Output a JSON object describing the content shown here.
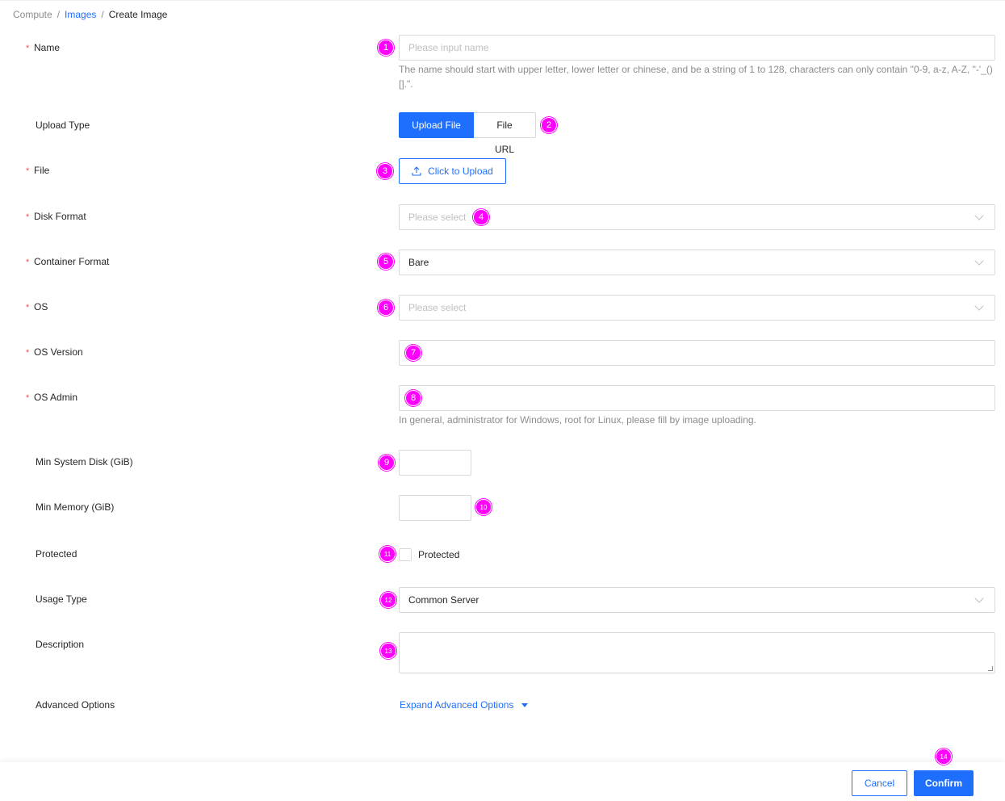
{
  "breadcrumb": {
    "items": [
      "Compute",
      "Images",
      "Create Image"
    ],
    "sep": "/"
  },
  "required_mark": "*",
  "form": {
    "name": {
      "label": "Name",
      "placeholder": "Please input name",
      "help": "The name should start with upper letter, lower letter or chinese, and be a string of 1 to 128, characters can only contain \"0-9, a-z, A-Z, \"-'_()[].\"."
    },
    "upload_type": {
      "label": "Upload Type",
      "options": [
        "Upload File",
        "File URL"
      ],
      "selected": "Upload File"
    },
    "file": {
      "label": "File",
      "button": "Click to Upload"
    },
    "disk_format": {
      "label": "Disk Format",
      "placeholder": "Please select"
    },
    "container_format": {
      "label": "Container Format",
      "value": "Bare"
    },
    "os": {
      "label": "OS",
      "placeholder": "Please select"
    },
    "os_version": {
      "label": "OS Version",
      "value": ""
    },
    "os_admin": {
      "label": "OS Admin",
      "value": "",
      "help": "In general, administrator for Windows, root for Linux, please fill by image uploading."
    },
    "min_system_disk": {
      "label": "Min System Disk (GiB)",
      "value": ""
    },
    "min_memory": {
      "label": "Min Memory (GiB)",
      "value": ""
    },
    "protected": {
      "label": "Protected",
      "checkbox_label": "Protected",
      "checked": false
    },
    "usage_type": {
      "label": "Usage Type",
      "value": "Common Server"
    },
    "description": {
      "label": "Description",
      "value": ""
    },
    "advanced": {
      "label": "Advanced Options",
      "link": "Expand Advanced Options"
    }
  },
  "footer": {
    "cancel": "Cancel",
    "confirm": "Confirm"
  },
  "markers": [
    "1",
    "2",
    "3",
    "4",
    "5",
    "6",
    "7",
    "8",
    "9",
    "10",
    "11",
    "12",
    "13",
    "14"
  ],
  "colors": {
    "primary": "#1f6fff",
    "required": "#ff4d4f",
    "marker": "#ff00ff"
  }
}
